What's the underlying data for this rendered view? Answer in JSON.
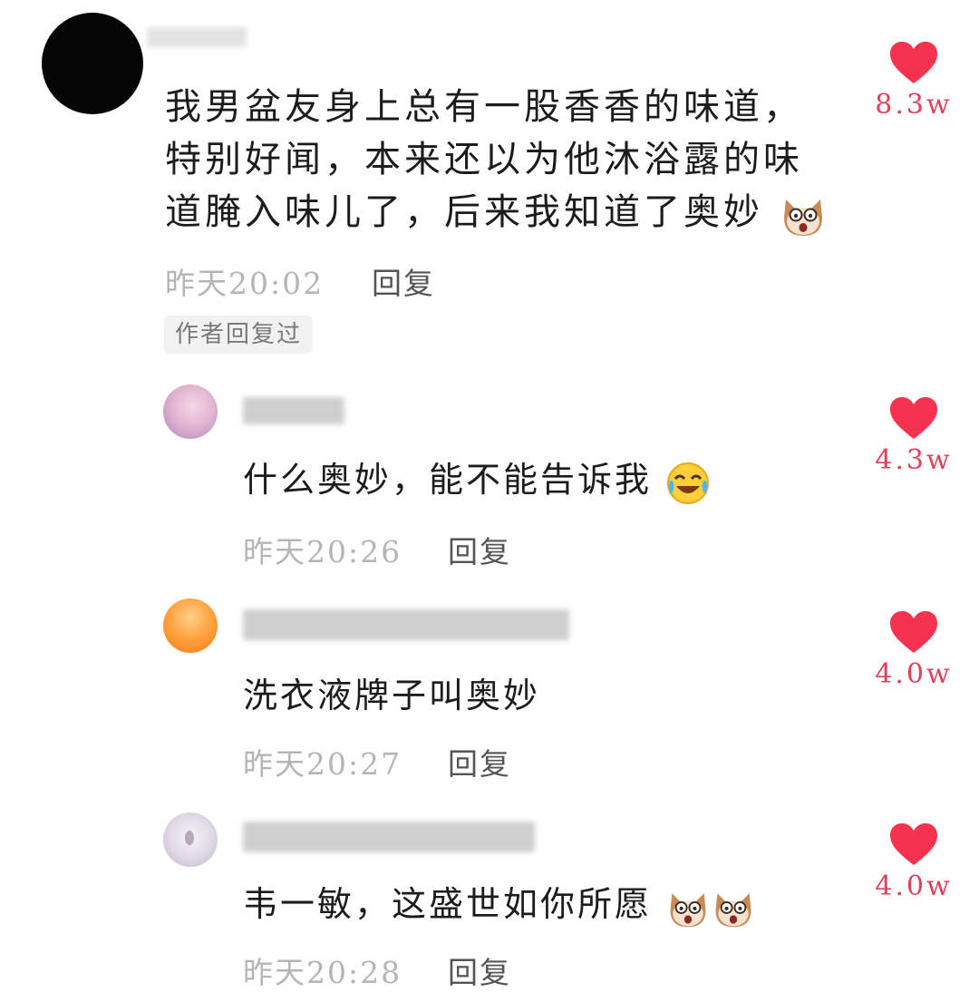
{
  "comments": [
    {
      "text_lines": [
        "我男盆友身上总有一股香香的味道，",
        "特别好闻，本来还以为他沐浴露的味",
        "道腌入味儿了，后来我知道了奥妙"
      ],
      "emoji": "dog-face-emoji",
      "time": "昨天20:02",
      "reply_label": "回复",
      "author_tag": "作者回复过",
      "likes": "8.3w",
      "avatar": "black-circle-avatar"
    }
  ],
  "replies": [
    {
      "text": "什么奥妙，能不能告诉我",
      "emoji": "laughing-crying-emoji",
      "time": "昨天20:26",
      "reply_label": "回复",
      "likes": "4.3w",
      "avatar": "pink-anime-avatar"
    },
    {
      "text": "洗衣液牌子叫奥妙",
      "time": "昨天20:27",
      "reply_label": "回复",
      "likes": "4.0w",
      "avatar": "orange-circle-avatar"
    },
    {
      "text": "韦一敏，这盛世如你所愿",
      "emoji": "dog-face-emoji",
      "time": "昨天20:28",
      "reply_label": "回复",
      "likes": "4.0w",
      "avatar": "pale-girl-avatar"
    }
  ],
  "colors": {
    "heart": "#f5324f",
    "like_count": "#e0415a",
    "time": "#b5b5b5"
  }
}
